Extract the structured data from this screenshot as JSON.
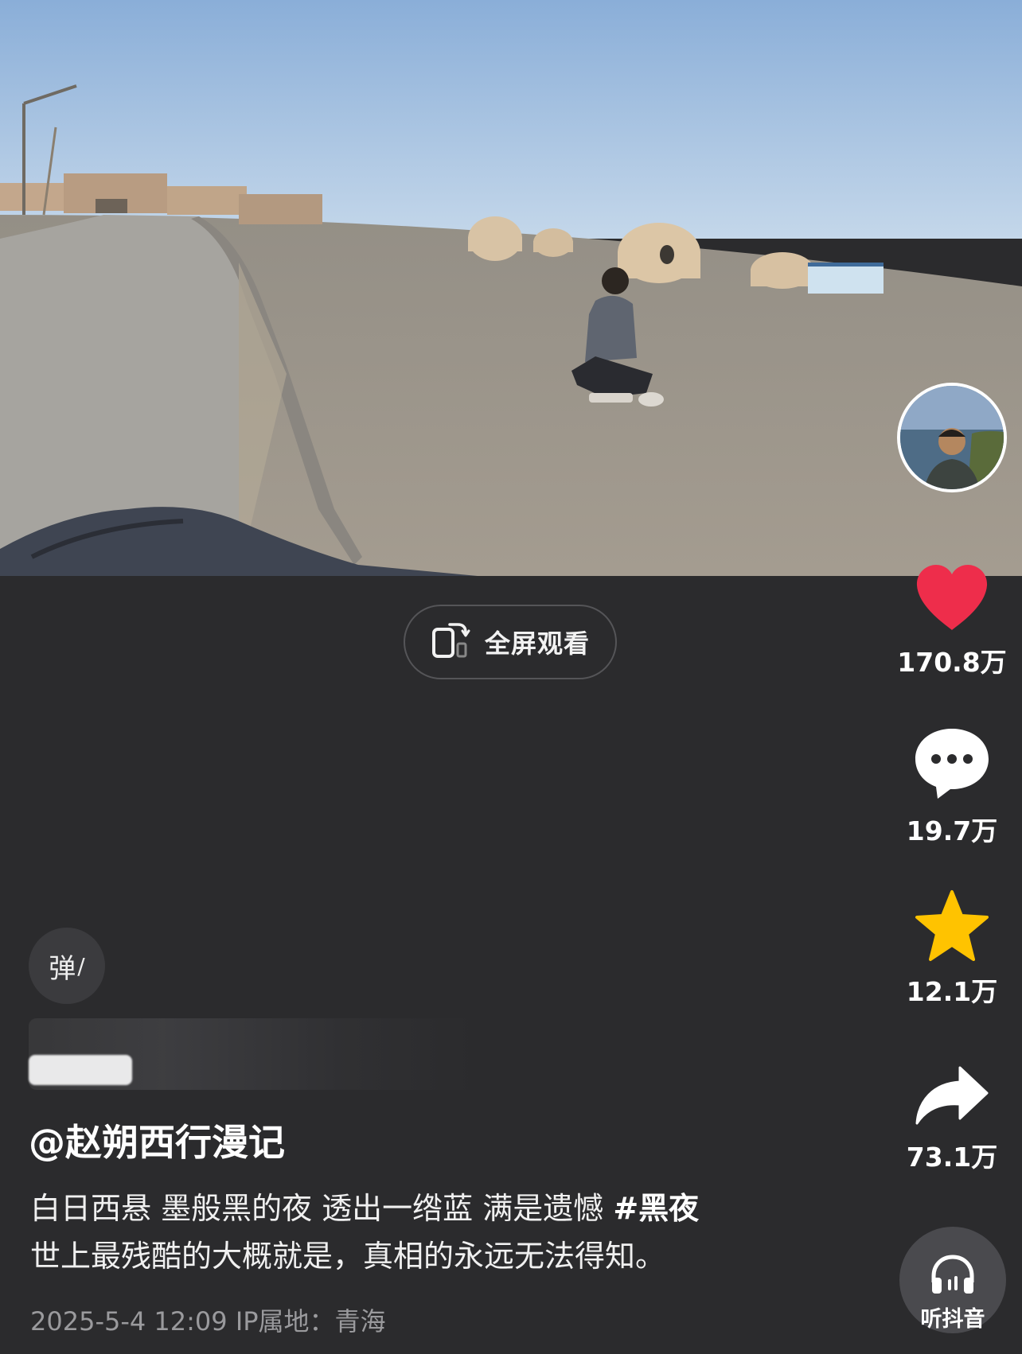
{
  "video": {
    "scene": "desert-scene"
  },
  "fullscreen": {
    "label": "全屏观看",
    "icon": "rotate-phone-icon"
  },
  "actions": {
    "like": {
      "count": "170.8万",
      "icon": "heart-icon",
      "color": "#ee2d4b"
    },
    "comment": {
      "count": "19.7万",
      "icon": "comment-bubble-icon",
      "color": "#ffffff"
    },
    "favorite": {
      "count": "12.1万",
      "icon": "star-icon",
      "color": "#ffc300"
    },
    "share": {
      "count": "73.1万",
      "icon": "share-arrow-icon",
      "color": "#ffffff"
    },
    "listen": {
      "label": "听抖音",
      "icon": "headphones-icon"
    }
  },
  "danmaku": {
    "label": "弹"
  },
  "post": {
    "author": "@赵朔西行漫记",
    "description_line1": "白日西悬 墨般黑的夜 透出一绺蓝 满是遗憾 ",
    "hashtag": "#黑夜",
    "description_line2": "世上最残酷的大概就是，真相的永远无法得知。",
    "meta": "2025-5-4 12:09  IP属地：青海"
  }
}
